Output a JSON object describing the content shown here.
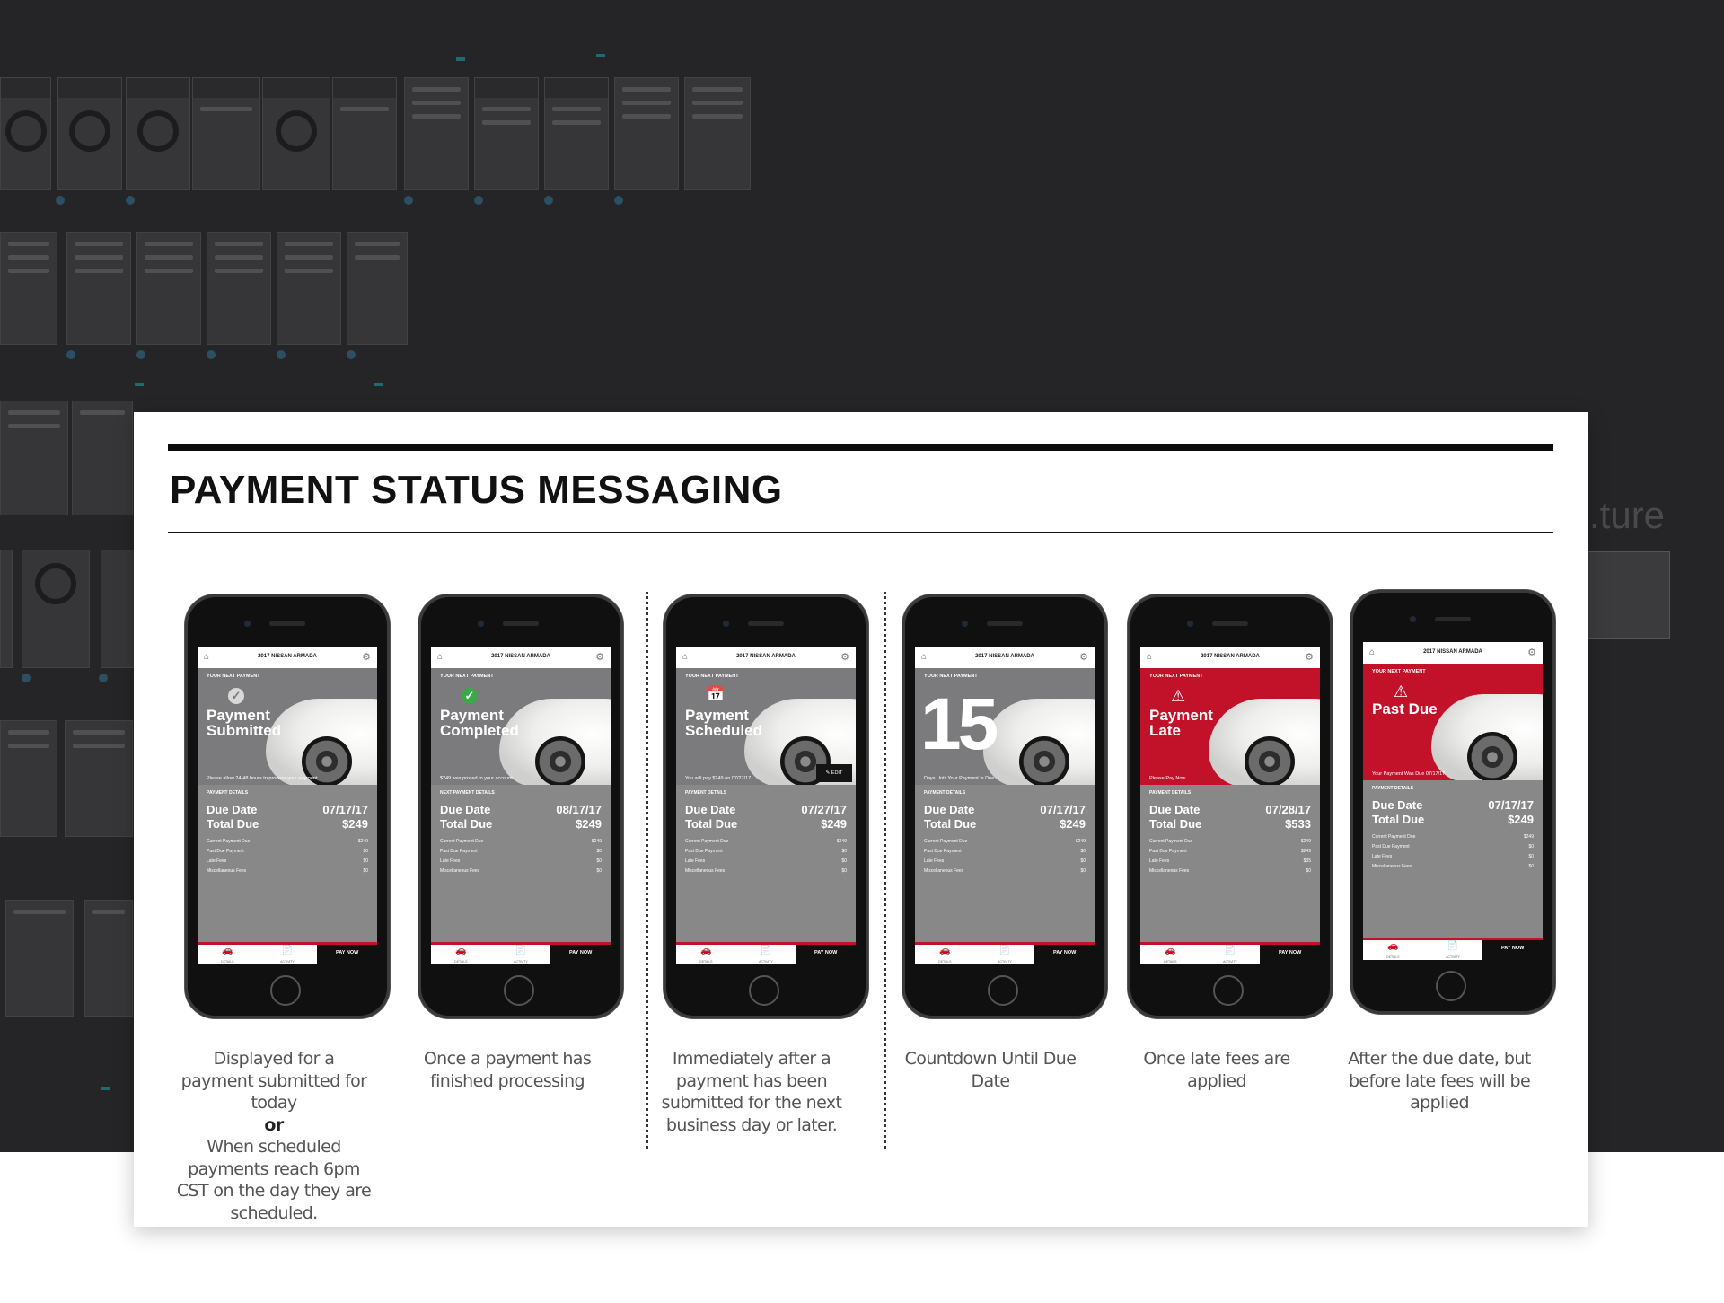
{
  "document": {
    "title": "PAYMENT STATUS MESSAGING"
  },
  "background": {
    "ghost_text": ".ture"
  },
  "icons": {
    "home": "home-icon",
    "gear": "gear-icon",
    "check": "check-icon",
    "calendar": "calendar-icon",
    "warning": "warning-icon",
    "edit": "pencil-icon",
    "car": "car-icon",
    "document": "document-icon"
  },
  "colors": {
    "brand_red": "#c1122a",
    "screen_gray": "#888888",
    "success_green": "#3ca84a"
  },
  "phones": [
    {
      "vehicle": "2017 NISSAN ARMADA",
      "next_label": "YOUR NEXT PAYMENT",
      "status_title": "Payment\nSubmitted",
      "caption": "Please allow 24-48 hours to process your payment",
      "details_label": "PAYMENT DETAILS",
      "due_date_label": "Due Date",
      "due_date": "07/17/17",
      "total_due_label": "Total Due",
      "total_due": "$249",
      "current_payment_label": "Current Payment Due",
      "current_payment": "$249",
      "past_due_label": "Past Due Payment",
      "past_due": "$0",
      "late_fees_label": "Late Fees",
      "late_fees": "$0",
      "misc_fees_label": "Miscellaneous Fees",
      "misc_fees": "$0",
      "tab_details": "DETAILS",
      "tab_activity": "ACTIVITY",
      "pay_now": "PAY NOW",
      "description_lines": [
        "Displayed for a payment submitted for today",
        "or",
        "When scheduled payments reach 6pm CST on the day they are scheduled."
      ]
    },
    {
      "vehicle": "2017 NISSAN ARMADA",
      "next_label": "YOUR NEXT PAYMENT",
      "status_title": "Payment\nCompleted",
      "caption": "$249 was posted to your account",
      "details_label": "NEXT PAYMENT DETAILS",
      "due_date_label": "Due Date",
      "due_date": "08/17/17",
      "total_due_label": "Total Due",
      "total_due": "$249",
      "current_payment_label": "Current Payment Due",
      "current_payment": "$249",
      "past_due_label": "Past Due Payment",
      "past_due": "$0",
      "late_fees_label": "Late Fees",
      "late_fees": "$0",
      "misc_fees_label": "Miscellaneous Fees",
      "misc_fees": "$0",
      "tab_details": "DETAILS",
      "tab_activity": "ACTIVITY",
      "pay_now": "PAY NOW",
      "description_lines": [
        "Once a payment has finished processing"
      ]
    },
    {
      "vehicle": "2017 NISSAN ARMADA",
      "next_label": "YOUR NEXT PAYMENT",
      "status_title": "Payment\nScheduled",
      "caption": "You will pay $249 on 07/27/17",
      "edit_label": "EDIT",
      "details_label": "PAYMENT DETAILS",
      "due_date_label": "Due Date",
      "due_date": "07/27/17",
      "total_due_label": "Total Due",
      "total_due": "$249",
      "current_payment_label": "Current Payment Due",
      "current_payment": "$249",
      "past_due_label": "Past Due Payment",
      "past_due": "$0",
      "late_fees_label": "Late Fees",
      "late_fees": "$0",
      "misc_fees_label": "Miscellaneous Fees",
      "misc_fees": "$0",
      "tab_details": "DETAILS",
      "tab_activity": "ACTIVITY",
      "pay_now": "PAY NOW",
      "description_lines": [
        "Immediately after a payment has been submitted for the next business day or later."
      ]
    },
    {
      "vehicle": "2017 NISSAN ARMADA",
      "next_label": "YOUR NEXT PAYMENT",
      "countdown": "15",
      "caption": "Days Until Your Payment Is Due",
      "details_label": "PAYMENT DETAILS",
      "due_date_label": "Due Date",
      "due_date": "07/17/17",
      "total_due_label": "Total Due",
      "total_due": "$249",
      "current_payment_label": "Current Payment Due",
      "current_payment": "$249",
      "past_due_label": "Past Due Payment",
      "past_due": "$0",
      "late_fees_label": "Late Fees",
      "late_fees": "$0",
      "misc_fees_label": "Miscellaneous Fees",
      "misc_fees": "$0",
      "tab_details": "DETAILS",
      "tab_activity": "ACTIVITY",
      "pay_now": "PAY NOW",
      "description_lines": [
        "Countdown Until Due Date"
      ]
    },
    {
      "vehicle": "2017 NISSAN ARMADA",
      "next_label": "YOUR NEXT PAYMENT",
      "status_title": "Payment\nLate",
      "caption": "Please Pay Now",
      "details_label": "PAYMENT DETAILS",
      "due_date_label": "Due Date",
      "due_date": "07/28/17",
      "total_due_label": "Total Due",
      "total_due": "$533",
      "current_payment_label": "Current Payment Due",
      "current_payment": "$249",
      "past_due_label": "Past Due Payment",
      "past_due": "$249",
      "late_fees_label": "Late Fees",
      "late_fees": "$35",
      "misc_fees_label": "Miscellaneous Fees",
      "misc_fees": "$0",
      "tab_details": "DETAILS",
      "tab_activity": "ACTIVITY",
      "pay_now": "PAY NOW",
      "description_lines": [
        "Once late fees are applied"
      ]
    },
    {
      "vehicle": "2017 NISSAN ARMADA",
      "next_label": "YOUR NEXT PAYMENT",
      "status_title": "Past Due",
      "caption": "Your Payment Was Due 07/17/17",
      "details_label": "PAYMENT DETAILS",
      "due_date_label": "Due Date",
      "due_date": "07/17/17",
      "total_due_label": "Total Due",
      "total_due": "$249",
      "current_payment_label": "Current Payment Due",
      "current_payment": "$249",
      "past_due_label": "Past Due Payment",
      "past_due": "$0",
      "late_fees_label": "Late Fees",
      "late_fees": "$0",
      "misc_fees_label": "Miscellaneous Fees",
      "misc_fees": "$0",
      "tab_details": "DETAILS",
      "tab_activity": "ACTIVITY",
      "pay_now": "PAY NOW",
      "description_lines": [
        "After the due date, but before late fees will be applied"
      ]
    }
  ]
}
